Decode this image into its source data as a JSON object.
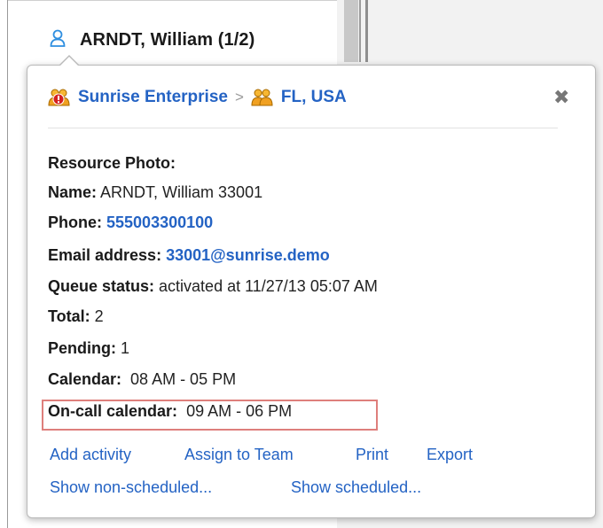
{
  "header": {
    "title": "ARNDT, William (1/2)"
  },
  "popup": {
    "breadcrumb": {
      "org": "Sunrise Enterprise",
      "separator": ">",
      "location": "FL, USA"
    },
    "details": {
      "photo_label": "Resource Photo:",
      "name_label": "Name:",
      "name_value": " ARNDT, William 33001",
      "phone_label": "Phone:",
      "phone_value": "555003300100",
      "email_label": "Email address:",
      "email_value": "33001@sunrise.demo",
      "queue_label": "Queue status:",
      "queue_value": " activated at 11/27/13 05:07 AM",
      "total_label": "Total:",
      "total_value": " 2",
      "pending_label": "Pending:",
      "pending_value": " 1",
      "calendar_label": "Calendar:",
      "calendar_value": "  08 AM - 05 PM",
      "oncall_label": "On-call calendar:",
      "oncall_value": "  09 AM - 06 PM"
    },
    "actions": {
      "add_activity": "Add activity",
      "assign_team": "Assign to Team",
      "print": "Print",
      "export": "Export",
      "show_non_scheduled": "Show non-scheduled...",
      "show_scheduled": "Show scheduled..."
    }
  },
  "colors": {
    "link": "#2463c4",
    "highlight": "#de7f7c",
    "user_icon": "#2f8fe0"
  },
  "icons": {
    "user": "user-icon",
    "org": "org-alert-icon",
    "group": "group-icon",
    "close": "close-icon"
  }
}
